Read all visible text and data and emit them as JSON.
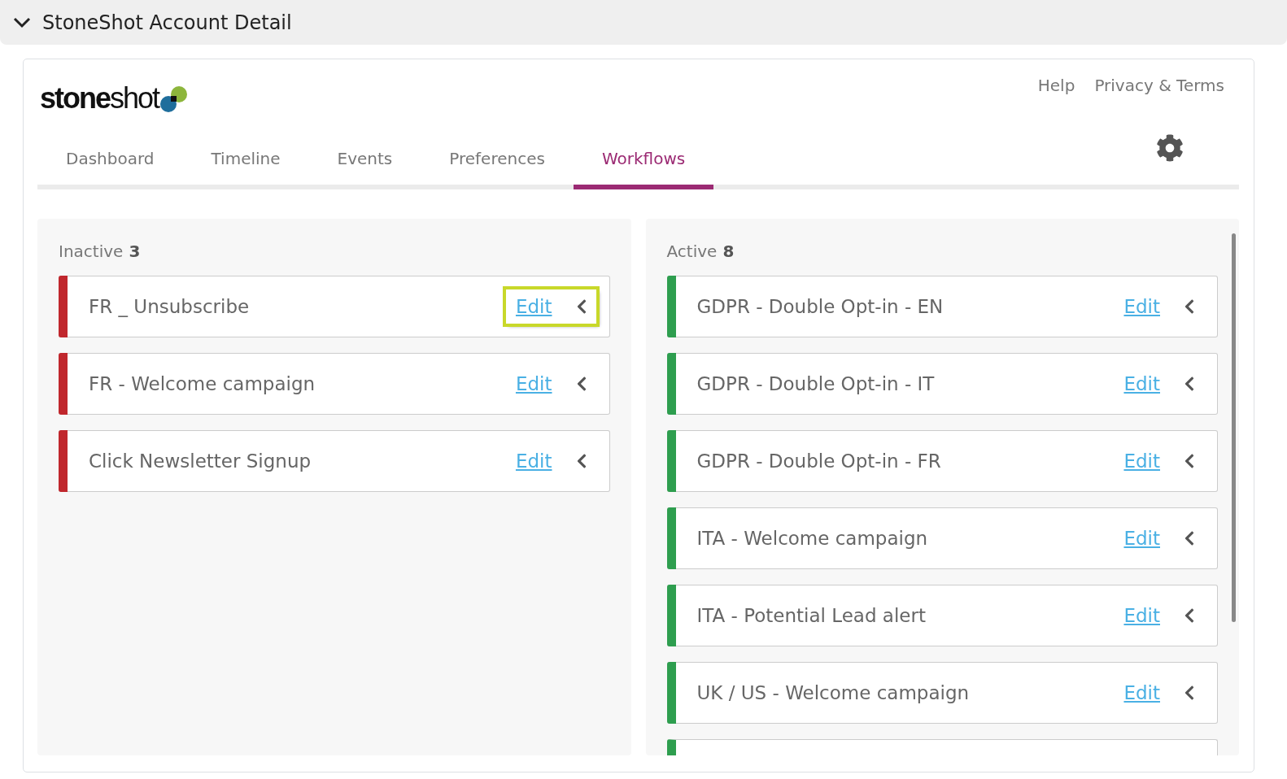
{
  "section": {
    "title": "StoneShot Account Detail",
    "expanded": true
  },
  "logo": {
    "text": "**stone**shot"
  },
  "links": [
    "Help",
    "Privacy & Terms"
  ],
  "tabs": [
    {
      "label": "Dashboard",
      "selected": false
    },
    {
      "label": "Timeline",
      "selected": false
    },
    {
      "label": "Events",
      "selected": false
    },
    {
      "label": "Preferences",
      "selected": false
    },
    {
      "label": "Workflows",
      "selected": true
    }
  ],
  "panels": [
    {
      "label": "Inactive",
      "count": "3",
      "color": "#c0272d",
      "items": [
        {
          "name": "FR _ Unsubscribe",
          "action": "Edit",
          "highlighted": true
        },
        {
          "name": "FR - Welcome campaign",
          "action": "Edit",
          "highlighted": false
        },
        {
          "name": "Click Newsletter Signup",
          "action": "Edit",
          "highlighted": false
        }
      ]
    },
    {
      "label": "Active",
      "count": "8",
      "color": "#2e9e4f",
      "partial_card": true,
      "scrollbar": true,
      "items": [
        {
          "name": "GDPR - Double Opt-in - EN",
          "action": "Edit",
          "highlighted": false
        },
        {
          "name": "GDPR - Double Opt-in - IT",
          "action": "Edit",
          "highlighted": false
        },
        {
          "name": "GDPR - Double Opt-in - FR",
          "action": "Edit",
          "highlighted": false
        },
        {
          "name": "ITA - Welcome campaign",
          "action": "Edit",
          "highlighted": false
        },
        {
          "name": "ITA - Potential Lead alert",
          "action": "Edit",
          "highlighted": false
        },
        {
          "name": "UK / US - Welcome campaign",
          "action": "Edit",
          "highlighted": false
        }
      ]
    }
  ]
}
